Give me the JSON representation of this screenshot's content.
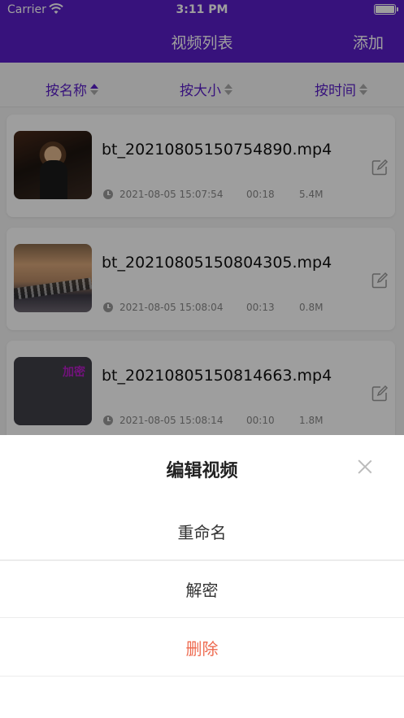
{
  "status": {
    "carrier": "Carrier",
    "time": "3:11 PM"
  },
  "nav": {
    "title": "视频列表",
    "add_label": "添加"
  },
  "sort": [
    {
      "label": "按名称",
      "active": "up"
    },
    {
      "label": "按大小",
      "active": "none"
    },
    {
      "label": "按时间",
      "active": "none"
    }
  ],
  "videos": [
    {
      "name": "bt_20210805150754890.mp4",
      "date": "2021-08-05 15:07:54",
      "duration": "00:18",
      "size": "5.4M"
    },
    {
      "name": "bt_20210805150804305.mp4",
      "date": "2021-08-05 15:08:04",
      "duration": "00:13",
      "size": "0.8M"
    },
    {
      "name": "bt_20210805150814663.mp4",
      "date": "2021-08-05 15:08:14",
      "duration": "00:10",
      "size": "1.8M",
      "thumb_label": "加密"
    }
  ],
  "sheet": {
    "title": "编辑视频",
    "options": [
      "重命名",
      "解密",
      "删除"
    ],
    "delete_color": "#ee6a4f"
  },
  "colors": {
    "accent": "#5a1ec9"
  }
}
